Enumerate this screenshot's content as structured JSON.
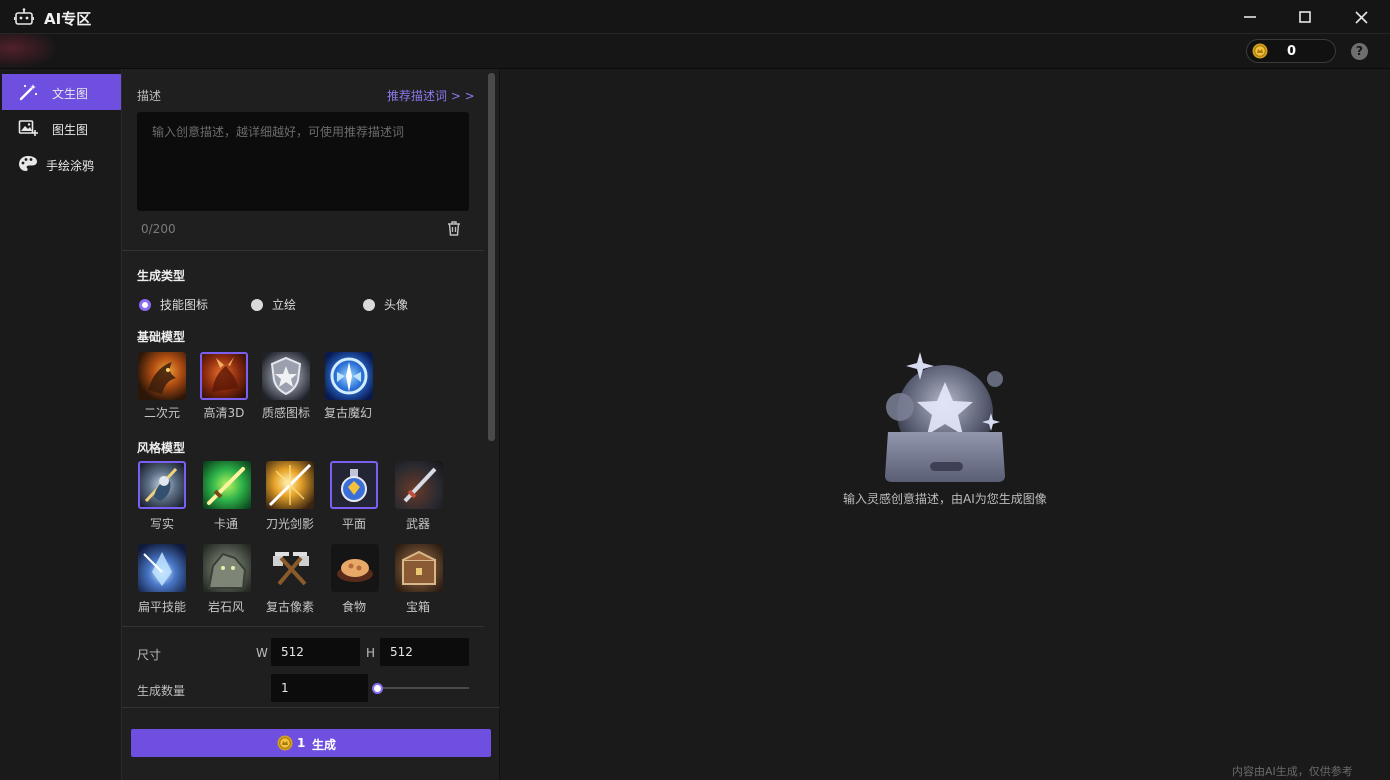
{
  "app": {
    "title": "AI专区",
    "coin_balance": "0",
    "help": "?"
  },
  "nav": {
    "items": [
      {
        "label": "文生图",
        "icon": "magic-wand-icon",
        "active": true
      },
      {
        "label": "图生图",
        "icon": "image-plus-icon",
        "active": false
      },
      {
        "label": "手绘涂鸦",
        "icon": "palette-icon",
        "active": false
      }
    ]
  },
  "form": {
    "description_label": "描述",
    "recommend_link": "推荐描述词 > >",
    "description_placeholder": "输入创意描述，越详细越好，可使用推荐描述词",
    "char_counter": "0/200",
    "type_label": "生成类型",
    "types": [
      {
        "label": "技能图标",
        "selected": true
      },
      {
        "label": "立绘",
        "selected": false
      },
      {
        "label": "头像",
        "selected": false
      }
    ],
    "base_model_label": "基础模型",
    "base_models": [
      {
        "label": "二次元",
        "selected": false
      },
      {
        "label": "高清3D",
        "selected": true
      },
      {
        "label": "质感图标",
        "selected": false
      },
      {
        "label": "复古魔幻",
        "selected": false
      }
    ],
    "style_model_label": "风格模型",
    "style_models": [
      {
        "label": "写实",
        "selected": true
      },
      {
        "label": "卡通",
        "selected": false
      },
      {
        "label": "刀光剑影",
        "selected": false
      },
      {
        "label": "平面",
        "selected": true
      },
      {
        "label": "武器",
        "selected": false
      },
      {
        "label": "扁平技能",
        "selected": false
      },
      {
        "label": "岩石风",
        "selected": false
      },
      {
        "label": "复古像素",
        "selected": false
      },
      {
        "label": "食物",
        "selected": false
      },
      {
        "label": "宝箱",
        "selected": false
      }
    ],
    "size_label": "尺寸",
    "width_prefix": "W",
    "width_value": "512",
    "height_prefix": "H",
    "height_value": "512",
    "count_label": "生成数量",
    "count_value": "1",
    "generate_cost": "1",
    "generate_label": "生成"
  },
  "main": {
    "empty_text": "输入灵感创意描述，由AI为您生成图像",
    "footnote": "内容由AI生成，仅供参考"
  },
  "colors": {
    "accent": "#6e4fe0",
    "accent_light": "#8d79f0",
    "background": "#1a1a1a",
    "panel": "#1f1f1f"
  }
}
